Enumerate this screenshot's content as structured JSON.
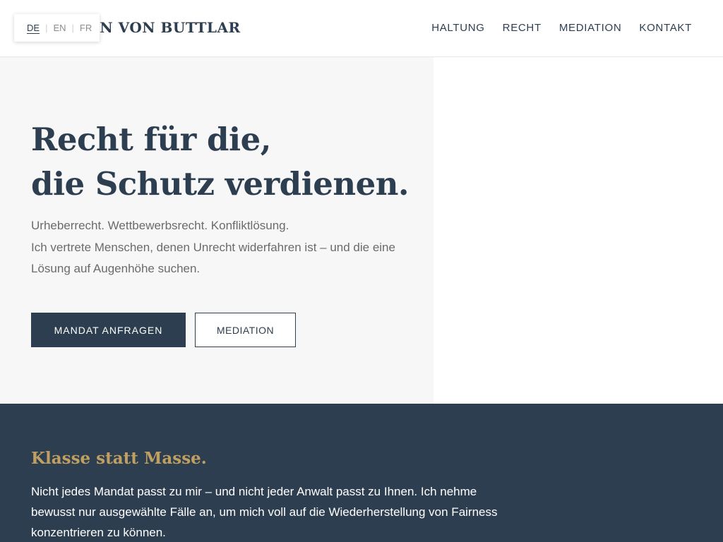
{
  "header": {
    "logo_text": "BAN VON BUTTLAR",
    "languages": [
      {
        "code": "DE",
        "active": true
      },
      {
        "code": "EN",
        "active": false
      },
      {
        "code": "FR",
        "active": false
      }
    ],
    "nav": [
      "HALTUNG",
      "RECHT",
      "MEDIATION",
      "KONTAKT"
    ]
  },
  "hero": {
    "title_line1": "Recht für die,",
    "title_line2": "die Schutz verdienen.",
    "text_line1": "Urheberrecht. Wettbewerbsrecht. Konfliktlösung.",
    "text_line2": "Ich vertrete Menschen, denen Unrecht widerfahren ist – und die eine",
    "text_line3": "Lösung auf Augenhöhe suchen.",
    "primary_button": "MANDAT ANFRAGEN",
    "secondary_button": "MEDIATION"
  },
  "section": {
    "title": "Klasse statt Masse.",
    "text_line1": "Nicht jedes Mandat passt zu mir – und nicht jeder Anwalt passt zu Ihnen. Ich nehme",
    "text_line2": "bewusst nur ausgewählte Fälle an, um mich voll auf die Wiederherstellung von Fairness",
    "text_line3": "konzentrieren zu können."
  },
  "colors": {
    "navy": "#2d3e50",
    "gold": "#c0a060",
    "hero_bg": "#f7f7f7"
  }
}
